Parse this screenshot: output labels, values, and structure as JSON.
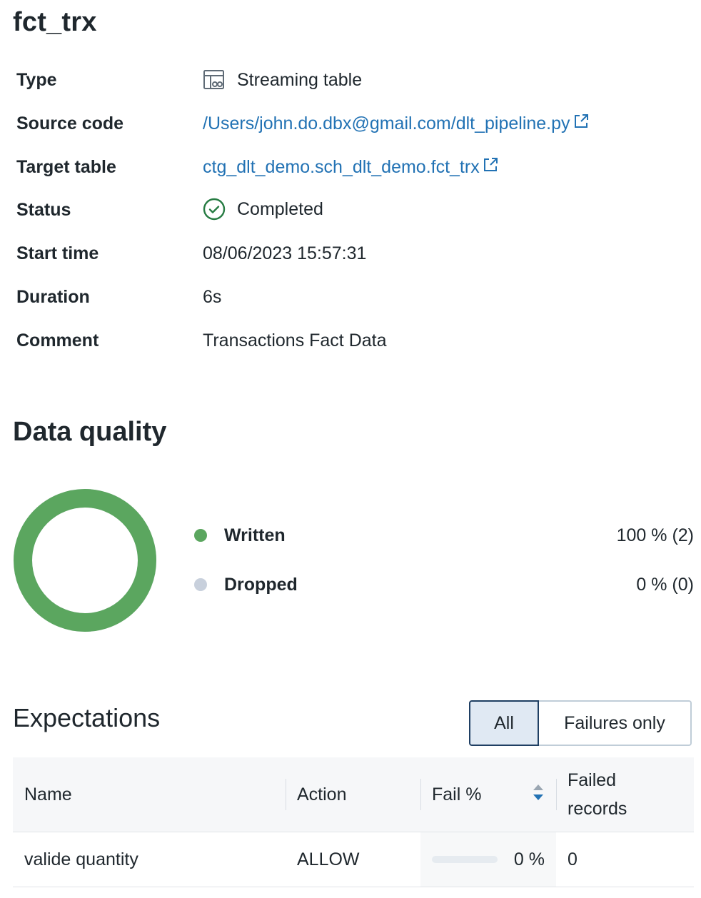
{
  "header": {
    "title": "fct_trx"
  },
  "details": {
    "type": {
      "label": "Type",
      "value": "Streaming table",
      "icon": "streaming-table-icon"
    },
    "source_code": {
      "label": "Source code",
      "value": "/Users/john.do.dbx@gmail.com/dlt_pipeline.py",
      "icon": "external-link-icon"
    },
    "target_table": {
      "label": "Target table",
      "value": "ctg_dlt_demo.sch_dlt_demo.fct_trx",
      "icon": "external-link-icon"
    },
    "status": {
      "label": "Status",
      "value": "Completed",
      "icon": "check-circle-icon"
    },
    "start_time": {
      "label": "Start time",
      "value": "08/06/2023 15:57:31"
    },
    "duration": {
      "label": "Duration",
      "value": "6s"
    },
    "comment": {
      "label": "Comment",
      "value": "Transactions Fact Data"
    }
  },
  "data_quality": {
    "title": "Data quality",
    "legend": [
      {
        "label": "Written",
        "value": "100 % (2)",
        "color": "#5ba65f"
      },
      {
        "label": "Dropped",
        "value": "0 % (0)",
        "color": "#c8d0dc"
      }
    ],
    "donut": {
      "written_fraction": 1.0,
      "dropped_fraction": 0.0
    }
  },
  "expectations": {
    "title": "Expectations",
    "filter": {
      "all_label": "All",
      "failures_label": "Failures only",
      "selected": "All"
    },
    "columns": {
      "name": "Name",
      "action": "Action",
      "fail_pct": "Fail %",
      "failed_records_1": "Failed",
      "failed_records_2": "records"
    },
    "rows": [
      {
        "name": "valide quantity",
        "action": "ALLOW",
        "fail_pct": "0 %",
        "fail_fraction": 0,
        "failed_records": "0"
      }
    ]
  },
  "colors": {
    "link": "#2272b4",
    "success": "#277c43",
    "written": "#5ba65f",
    "dropped": "#c8d0dc"
  }
}
